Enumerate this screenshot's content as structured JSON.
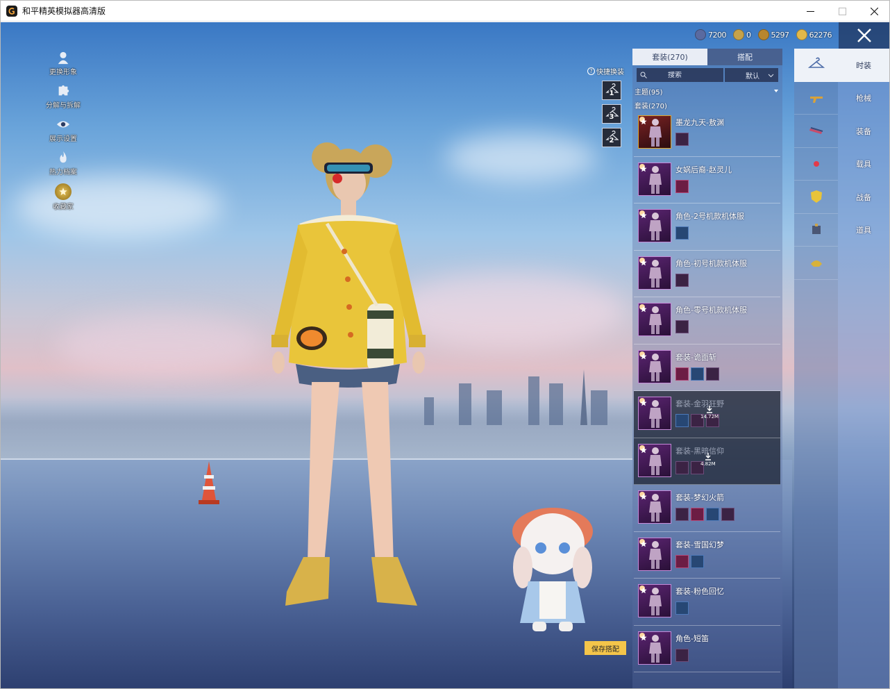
{
  "window": {
    "title": "和平精英模拟器高清版"
  },
  "left_tools": [
    {
      "label": "更换形象",
      "icon": "person-icon"
    },
    {
      "label": "分解与拆解",
      "icon": "puzzle-icon"
    },
    {
      "label": "展示设置",
      "icon": "eye-icon"
    },
    {
      "label": "热力档案",
      "icon": "flame-icon"
    },
    {
      "label": "收藏家",
      "icon": "collector-badge-icon"
    }
  ],
  "currency": [
    {
      "value": "7200",
      "icon": "coin-icon",
      "color": "#5a6aa0"
    },
    {
      "value": "0",
      "icon": "coin-icon",
      "color": "#c6a24a"
    },
    {
      "value": "5297",
      "icon": "coin-icon",
      "color": "#b8862e"
    },
    {
      "value": "62276",
      "icon": "coin-icon",
      "color": "#e2b84a"
    }
  ],
  "quick_swap": {
    "label": "快捷换装",
    "slots": [
      "1",
      "3",
      "2"
    ]
  },
  "panel": {
    "tabs": [
      "套装(270)",
      "搭配"
    ],
    "search_placeholder": "搜索",
    "sort": "默认",
    "theme": "主题(95)",
    "count": "套装(270)"
  },
  "outfits": [
    {
      "name": "墨龙九天-敖渊",
      "tier": "gold",
      "download_size": "",
      "subs": 1
    },
    {
      "name": "女娲后裔-赵灵儿",
      "tier": "purple",
      "download_size": "",
      "subs": 1
    },
    {
      "name": "角色-2号机款机体服",
      "tier": "purple",
      "download_size": "",
      "subs": 1
    },
    {
      "name": "角色-初号机款机体服",
      "tier": "purple",
      "download_size": "",
      "subs": 1
    },
    {
      "name": "角色-零号机款机体服",
      "tier": "purple",
      "download_size": "",
      "subs": 1
    },
    {
      "name": "套装-诡面斩",
      "tier": "purple",
      "download_size": "",
      "subs": 3
    },
    {
      "name": "套装-金羽狂野",
      "tier": "purple",
      "download_size": "14.72M",
      "subs": 3
    },
    {
      "name": "套装-黑暗信仰",
      "tier": "purple",
      "download_size": "4.82M",
      "subs": 2
    },
    {
      "name": "套装-梦幻火箭",
      "tier": "purple",
      "download_size": "",
      "subs": 4
    },
    {
      "name": "套装-雪国幻梦",
      "tier": "purple",
      "download_size": "",
      "subs": 2
    },
    {
      "name": "套装-粉色回忆",
      "tier": "purple",
      "download_size": "",
      "subs": 1
    },
    {
      "name": "角色-短笛",
      "tier": "purple",
      "download_size": "",
      "subs": 1
    }
  ],
  "save_button": "保存搭配",
  "categories": [
    {
      "label": "时装",
      "icon": "outfit-icon"
    },
    {
      "label": "枪械",
      "icon": "gun-icon"
    },
    {
      "label": "装备",
      "icon": "equipment-icon"
    },
    {
      "label": "载具",
      "icon": "vehicle-icon"
    },
    {
      "label": "战备",
      "icon": "combat-gear-icon"
    },
    {
      "label": "道具",
      "icon": "prop-icon"
    },
    {
      "label": "",
      "icon": "accessory-icon"
    }
  ],
  "colors": {
    "accent_gold": "#f4c54a",
    "panel_active": "#eef2f8",
    "purple_border": "#c58ad8"
  }
}
